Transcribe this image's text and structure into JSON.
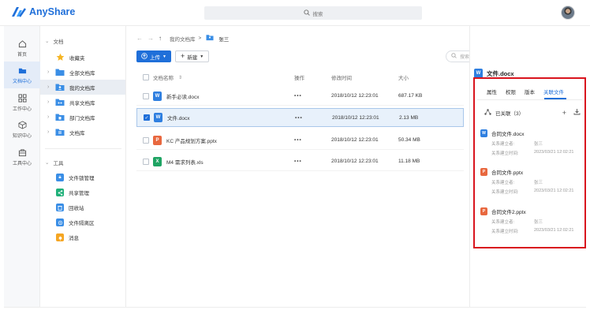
{
  "app": {
    "name": "AnyShare",
    "brand_color": "#1f6fd9"
  },
  "header": {
    "search_placeholder": "搜索"
  },
  "rail": [
    {
      "label": "首页",
      "icon": "home-icon",
      "active": false
    },
    {
      "label": "文档中心",
      "icon": "folder-icon",
      "active": true
    },
    {
      "label": "工作中心",
      "icon": "grid-icon",
      "active": false
    },
    {
      "label": "知识中心",
      "icon": "cube-icon",
      "active": false
    },
    {
      "label": "工具中心",
      "icon": "toolbox-icon",
      "active": false
    }
  ],
  "tree": {
    "docs_section": "文档",
    "items": [
      {
        "label": "收藏夹",
        "icon": "star-icon"
      },
      {
        "label": "全部文档库",
        "icon": "folder-icon"
      },
      {
        "label": "我的文档库",
        "icon": "user-folder-icon",
        "selected": true
      },
      {
        "label": "共享文档库",
        "icon": "shared-folder-icon"
      },
      {
        "label": "部门文档库",
        "icon": "dept-folder-icon"
      },
      {
        "label": "文档库",
        "icon": "library-folder-icon"
      }
    ],
    "tools_section": "工具",
    "tools": [
      {
        "label": "文件锁管理",
        "color": "#3a8ee6"
      },
      {
        "label": "共享管理",
        "color": "#20b17a"
      },
      {
        "label": "回收站",
        "color": "#3a8ee6"
      },
      {
        "label": "文件隔离区",
        "color": "#3a8ee6"
      },
      {
        "label": "消息",
        "color": "#f5a623"
      }
    ]
  },
  "breadcrumb": {
    "root": "我的文档库",
    "separator": ">",
    "current": "张三"
  },
  "toolbar": {
    "upload": "上传",
    "new": "新建"
  },
  "main_search_placeholder": "搜索文件关键字、路径",
  "table": {
    "headers": {
      "name": "文档名称",
      "ops": "操作",
      "time": "修改时间",
      "size": "大小"
    },
    "rows": [
      {
        "name": "新手必读.docx",
        "type": "word",
        "ops": "•••",
        "time": "2018/10/12 12:23:01",
        "size": "687.17 KB",
        "selected": false
      },
      {
        "name": "文件.docx",
        "type": "word",
        "ops": "•••",
        "time": "2018/10/12 12:23:01",
        "size": "2.13 MB",
        "selected": true
      },
      {
        "name": "KC 产品规划方案.pptx",
        "type": "ppt",
        "ops": "•••",
        "time": "2018/10/12 12:23:01",
        "size": "50.34 MB",
        "selected": false
      },
      {
        "name": "M4 需求列表.xls",
        "type": "excel",
        "ops": "•••",
        "time": "2018/10/12 12:23:01",
        "size": "11.18 MB",
        "selected": false
      }
    ]
  },
  "details": {
    "title": "文件.docx",
    "tabs": [
      "属性",
      "权限",
      "版本",
      "关联文件"
    ],
    "active_tab": "关联文件",
    "assoc_label": "已关联（3）",
    "assoc": [
      {
        "name": "合同文件.docx",
        "type": "word",
        "k1": "关系建立者:",
        "v1": "张三",
        "k2": "关系建立时间:",
        "v2": "2023/03/21 12:02:21"
      },
      {
        "name": "合同文件.pptx",
        "type": "ppt",
        "k1": "关系建立者:",
        "v1": "张三",
        "k2": "关系建立时间:",
        "v2": "2023/03/21 12:02:21"
      },
      {
        "name": "合同文件2.pptx",
        "type": "ppt",
        "k1": "关系建立者:",
        "v1": "张三",
        "k2": "关系建立时间:",
        "v2": "2023/03/21 12:02:21"
      }
    ]
  }
}
